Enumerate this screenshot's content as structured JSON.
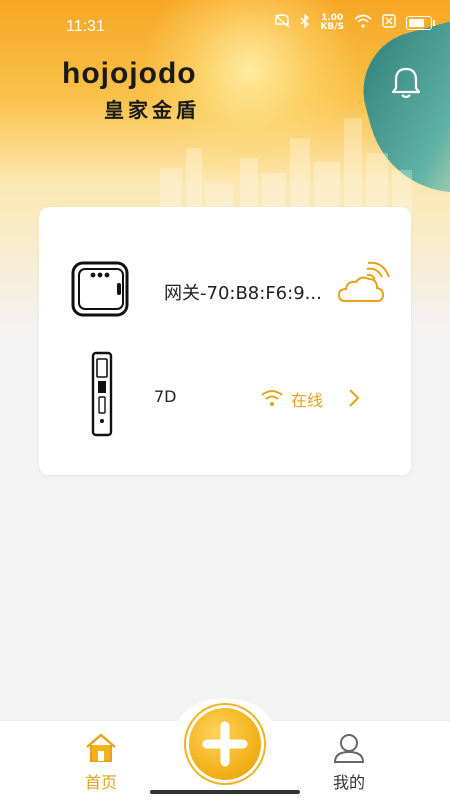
{
  "status_bar": {
    "time": "11:31",
    "speed_value": "1.00",
    "speed_unit": "KB/S"
  },
  "brand": {
    "name_en": "hojojodo",
    "name_cn": "皇家金盾"
  },
  "devices": [
    {
      "name": "网关-70:B8:F6:9...",
      "type": "gateway",
      "icon": "cloud-signal-icon"
    },
    {
      "name": "7D",
      "type": "lock",
      "status": "在线",
      "icon": "wifi-icon"
    }
  ],
  "tabbar": {
    "home_label": "首页",
    "mine_label": "我的"
  },
  "colors": {
    "accent": "#e5a21a",
    "header_start": "#f6a623",
    "background": "#f3f3f3"
  }
}
